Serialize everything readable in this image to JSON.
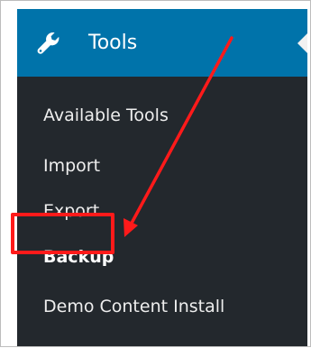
{
  "menu": {
    "title": "Tools",
    "icon": "wrench-icon",
    "items": [
      {
        "label": "Available Tools",
        "current": false
      },
      {
        "label": "Import",
        "current": false
      },
      {
        "label": "Export",
        "current": false
      },
      {
        "label": "Backup",
        "current": true
      },
      {
        "label": "Demo Content Install",
        "current": false
      }
    ]
  },
  "annotation": {
    "color": "#ff1a1a",
    "target": "Backup"
  },
  "colors": {
    "header_bg": "#0073aa",
    "sidebar_bg": "#23282d",
    "text": "#eeeeee"
  }
}
